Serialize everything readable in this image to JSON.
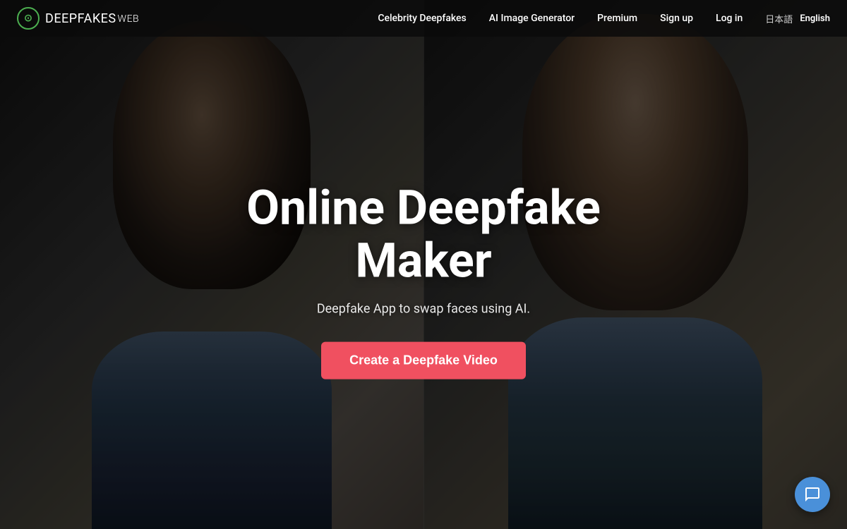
{
  "nav": {
    "logo": {
      "symbol": "⊙",
      "brand": "DEEPFAKES",
      "suffix": "WEB"
    },
    "links": [
      {
        "label": "Celebrity Deepfakes",
        "key": "celebrity-deepfakes"
      },
      {
        "label": "AI Image Generator",
        "key": "ai-image-generator"
      },
      {
        "label": "Premium",
        "key": "premium"
      },
      {
        "label": "Sign up",
        "key": "sign-up"
      },
      {
        "label": "Log in",
        "key": "log-in"
      }
    ],
    "lang": {
      "japanese": "日本語",
      "english": "English"
    }
  },
  "hero": {
    "title_line1": "Online Deepfake",
    "title_line2": "Maker",
    "subtitle": "Deepfake App to swap faces using AI.",
    "cta_label": "Create a Deepfake Video"
  },
  "chat": {
    "icon": "chat-icon"
  }
}
